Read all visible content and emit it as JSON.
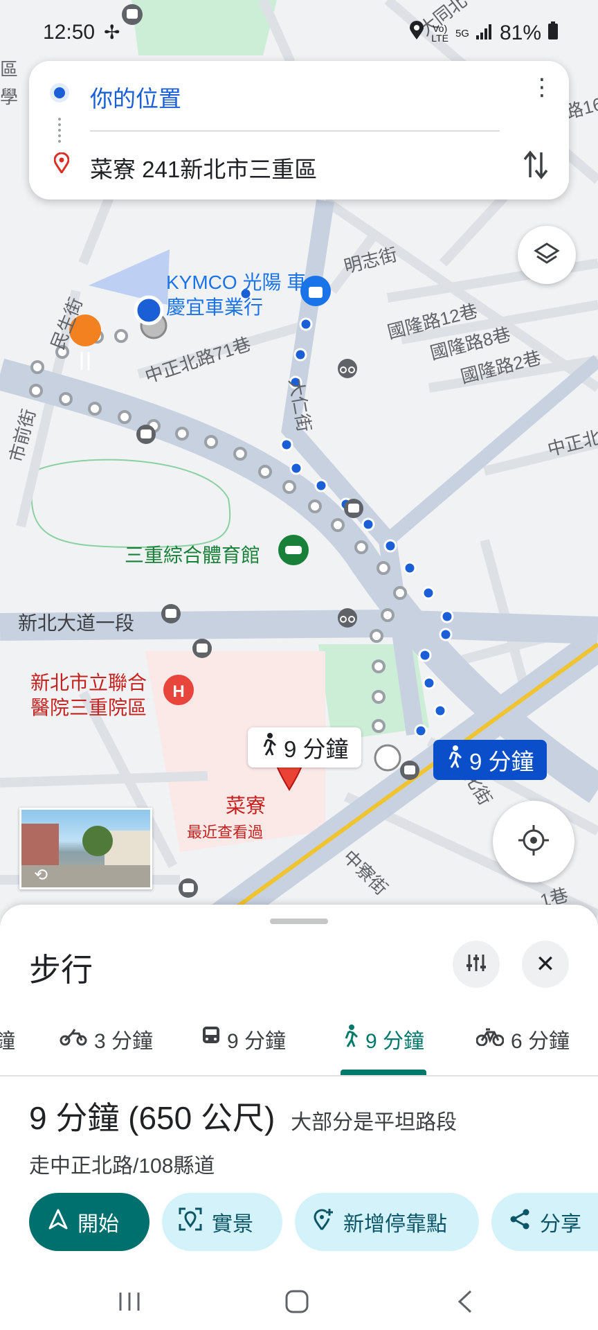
{
  "status": {
    "time": "12:50",
    "network": "5G",
    "battery": "81%"
  },
  "directions": {
    "origin": "你的位置",
    "destination": "菜寮 241新北市三重區"
  },
  "map": {
    "streets": [
      "明志街",
      "國隆路12巷",
      "國隆路8巷",
      "國隆路2巷",
      "中正北路71巷",
      "大仁街",
      "民生街",
      "市前街",
      "新北大道一段",
      "中正北",
      "中寮街",
      "大同北",
      "區",
      "學",
      "路16",
      "1巷",
      "化街"
    ],
    "pois": {
      "kymco": "KYMCO 光陽 車慶宜車業行",
      "gym": "三重綜合體育館",
      "hospital": "新北市立聯合 醫院三重院區",
      "dest_name": "菜寮",
      "dest_sub": "最近查看過"
    },
    "route_labels": {
      "alt": "9 分鐘",
      "main": "9 分鐘"
    }
  },
  "sheet": {
    "title": "步行",
    "tabs": [
      {
        "label": "鐘",
        "icon": "car-icon"
      },
      {
        "label": "3 分鐘",
        "icon": "motorcycle-icon"
      },
      {
        "label": "9 分鐘",
        "icon": "transit-icon"
      },
      {
        "label": "9 分鐘",
        "icon": "walk-icon",
        "active": true
      },
      {
        "label": "6 分鐘",
        "icon": "bike-icon"
      }
    ],
    "summary_time": "9 分鐘",
    "summary_dist": "(650 公尺)",
    "summary_note": "大部分是平坦路段",
    "via": "走中正北路/108縣道",
    "actions": {
      "start": "開始",
      "live": "實景",
      "add_stop": "新增停靠點",
      "share": "分享"
    }
  },
  "colors": {
    "route_blue": "#1a5fd6",
    "active_teal": "#00796b",
    "dest_red": "#ea4335"
  }
}
